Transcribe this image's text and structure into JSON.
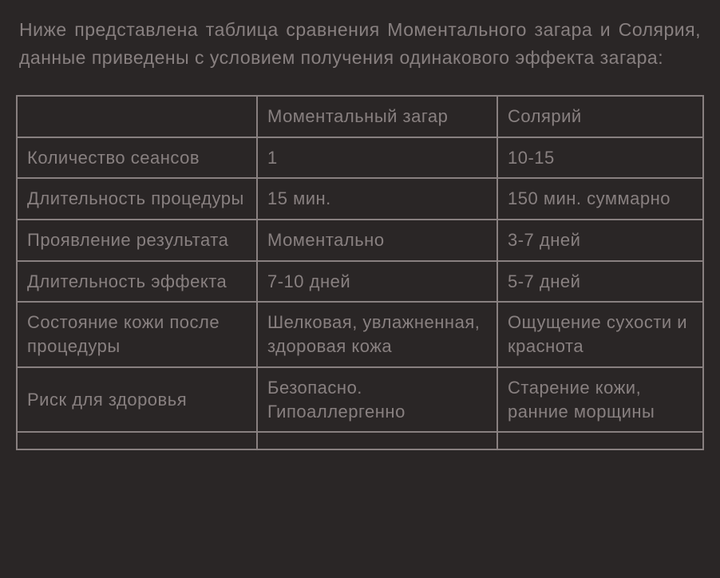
{
  "intro": "Ниже представлена таблица сравнения Моментального загара и Солярия, данные приведены с условием получения одинакового эффекта загара:",
  "table": {
    "header": {
      "col1": "",
      "col2": "Моментальный загар",
      "col3": "Солярий"
    },
    "rows": [
      {
        "label": "Количество сеансов",
        "c2": "1",
        "c3": "10-15"
      },
      {
        "label": "Длительность процедуры",
        "c2": "15 мин.",
        "c3": "150 мин. суммарно"
      },
      {
        "label": "Проявление результата",
        "c2": "Моментально",
        "c3": "3-7 дней"
      },
      {
        "label": "Длительность эффекта",
        "c2": "7-10 дней",
        "c3": "5-7 дней"
      },
      {
        "label": "Состояние кожи после процедуры",
        "c2": "Шелковая, увлажненная, здоровая кожа",
        "c3": "Ощущение сухости и краснота"
      },
      {
        "label": "Риск для здоровья",
        "c2": "Безопасно. Гипоаллергенно",
        "c3": "Старение кожи, ранние морщины"
      }
    ]
  }
}
